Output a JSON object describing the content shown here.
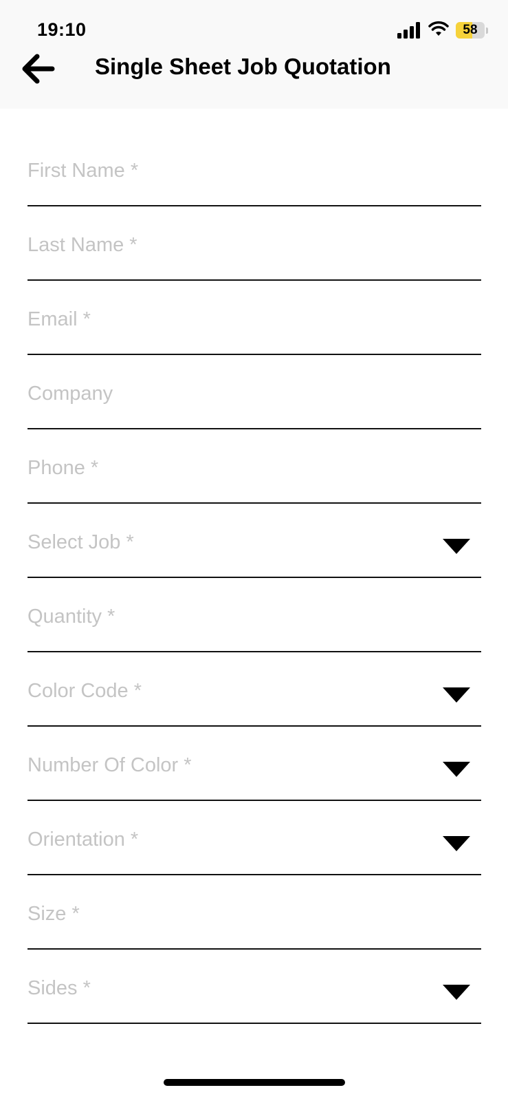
{
  "status_bar": {
    "time": "19:10",
    "battery_level": 58,
    "battery_label": "58",
    "icons": [
      "cellular-signal-icon",
      "wifi-icon",
      "battery-icon"
    ]
  },
  "app_bar": {
    "back_icon": "arrow-left-icon",
    "title": "Single Sheet Job Quotation"
  },
  "form": {
    "fields": [
      {
        "name": "first-name",
        "label": "First Name *",
        "type": "text"
      },
      {
        "name": "last-name",
        "label": "Last Name *",
        "type": "text"
      },
      {
        "name": "email",
        "label": "Email *",
        "type": "text"
      },
      {
        "name": "company",
        "label": "Company",
        "type": "text"
      },
      {
        "name": "phone",
        "label": "Phone *",
        "type": "text"
      },
      {
        "name": "select-job",
        "label": "Select Job *",
        "type": "dropdown"
      },
      {
        "name": "quantity",
        "label": "Quantity *",
        "type": "text"
      },
      {
        "name": "color-code",
        "label": "Color Code *",
        "type": "dropdown"
      },
      {
        "name": "number-of-color",
        "label": "Number Of Color *",
        "type": "dropdown"
      },
      {
        "name": "orientation",
        "label": "Orientation *",
        "type": "dropdown"
      },
      {
        "name": "size",
        "label": "Size *",
        "type": "text"
      },
      {
        "name": "sides",
        "label": "Sides *",
        "type": "dropdown"
      }
    ]
  },
  "colors": {
    "placeholder": "#c4c4c4",
    "underline": "#111111",
    "header_bg": "#f9f9f9",
    "battery_fill": "#f6d23a"
  }
}
